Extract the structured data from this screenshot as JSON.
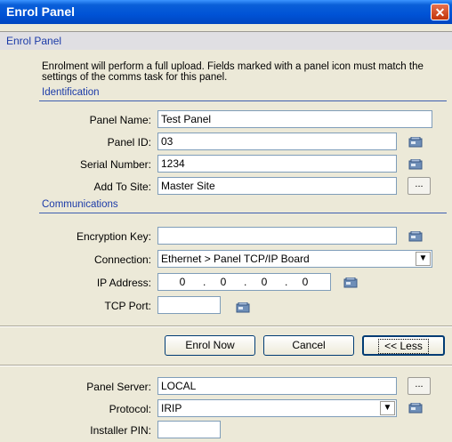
{
  "window": {
    "title": "Enrol Panel",
    "close_label": "✕"
  },
  "header": {
    "label": "Enrol Panel"
  },
  "description": "Enrolment will perform a full upload. Fields marked with a panel icon must match the settings of the comms task for this panel.",
  "identification": {
    "heading": "Identification",
    "panel_name": {
      "label": "Panel Name:",
      "value": "Test Panel"
    },
    "panel_id": {
      "label": "Panel ID:",
      "value": "03"
    },
    "serial_number": {
      "label": "Serial Number:",
      "value": "1234"
    },
    "add_to_site": {
      "label": "Add To Site:",
      "value": "Master Site",
      "browse": "..."
    }
  },
  "communications": {
    "heading": "Communications",
    "encryption_key": {
      "label": "Encryption Key:",
      "value": ""
    },
    "connection": {
      "label": "Connection:",
      "value": "Ethernet > Panel TCP/IP Board"
    },
    "ip_address": {
      "label": "IP Address:",
      "octets": [
        "0",
        "0",
        "0",
        "0"
      ]
    },
    "tcp_port": {
      "label": "TCP Port:",
      "value": ""
    }
  },
  "buttons": {
    "enrol_now": "Enrol Now",
    "cancel": "Cancel",
    "less": "<< Less"
  },
  "advanced": {
    "panel_server": {
      "label": "Panel Server:",
      "value": "LOCAL",
      "browse": "..."
    },
    "protocol": {
      "label": "Protocol:",
      "value": "IRIP"
    },
    "installer_pin": {
      "label": "Installer PIN:",
      "value": ""
    }
  },
  "colors": {
    "title_bar": "#0053d6",
    "dialog_bg": "#ece9d8",
    "group_heading": "#1c3ba8"
  }
}
